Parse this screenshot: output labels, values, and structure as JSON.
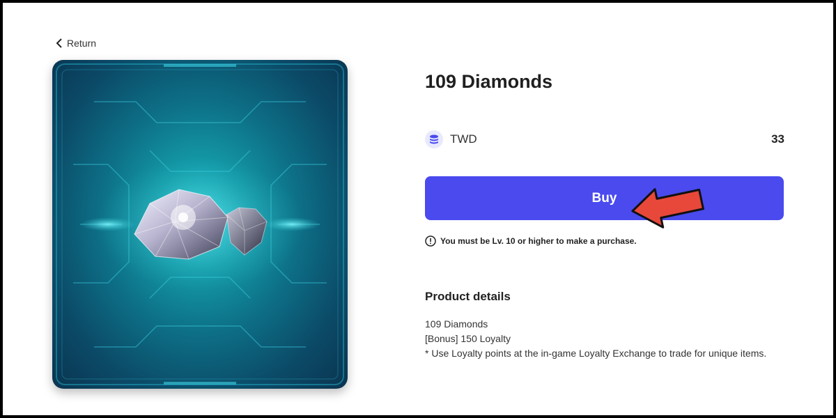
{
  "nav": {
    "return_label": "Return"
  },
  "product": {
    "title": "109 Diamonds",
    "image_icon": "diamond-icon",
    "currency": {
      "icon": "coin-stack-icon",
      "label": "TWD",
      "price": "33"
    },
    "buy_label": "Buy",
    "notice": "You must be Lv. 10 or higher to make a purchase.",
    "details_heading": "Product details",
    "details_lines": [
      "109 Diamonds",
      "[Bonus] 150 Loyalty",
      "* Use Loyalty points at the in-game Loyalty Exchange to trade for unique items."
    ]
  },
  "colors": {
    "accent": "#4a4aef",
    "annotation_arrow": "#e8483a",
    "card_teal": "#149aa8"
  }
}
